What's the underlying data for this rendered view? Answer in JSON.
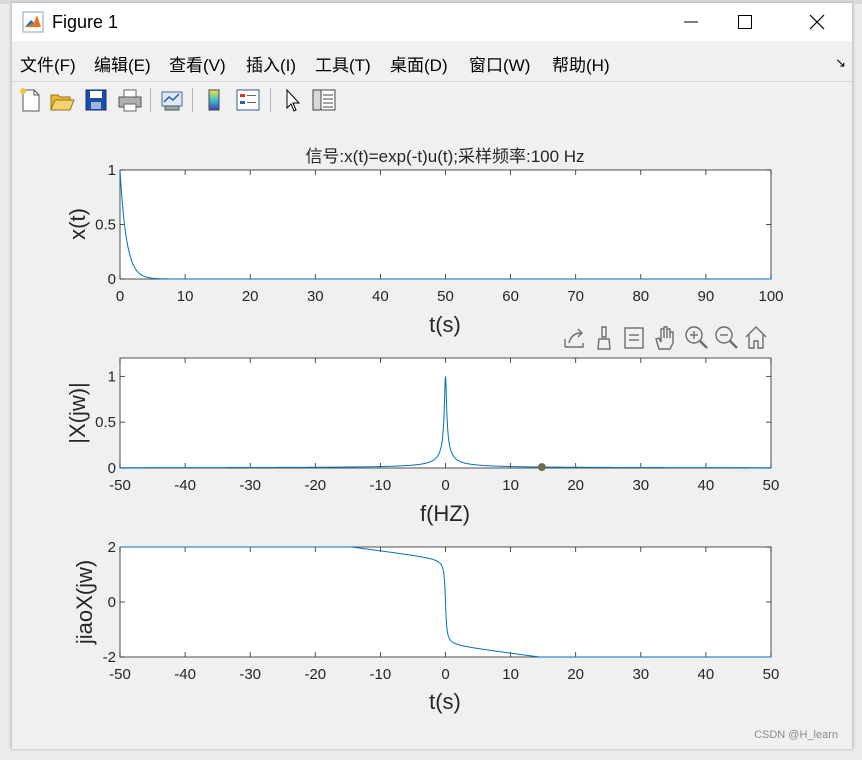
{
  "window": {
    "title": "Figure 1"
  },
  "menu": {
    "items": [
      {
        "label": "文件(F)"
      },
      {
        "label": "编辑(E)"
      },
      {
        "label": "查看(V)"
      },
      {
        "label": "插入(I)"
      },
      {
        "label": "工具(T)"
      },
      {
        "label": "桌面(D)"
      },
      {
        "label": "窗口(W)"
      },
      {
        "label": "帮助(H)"
      }
    ]
  },
  "toolbar": {
    "icons": [
      "new-figure-icon",
      "open-file-icon",
      "save-icon",
      "print-icon",
      "link-plot-icon",
      "colorbar-icon",
      "legend-icon",
      "pointer-icon",
      "property-inspector-icon"
    ]
  },
  "axes_toolbar": {
    "icons": [
      "export-icon",
      "brush-icon",
      "data-tips-icon",
      "pan-icon",
      "zoom-in-icon",
      "zoom-out-icon",
      "home-icon"
    ]
  },
  "watermark": "CSDN @H_learn",
  "chart_data": [
    {
      "type": "line",
      "title": "信号:x(t)=exp(-t)u(t);采样频率:100 Hz",
      "xlabel": "t(s)",
      "ylabel": "x(t)",
      "xlim": [
        0,
        100
      ],
      "ylim": [
        0,
        1
      ],
      "xticks": [
        "0",
        "10",
        "20",
        "30",
        "40",
        "50",
        "60",
        "70",
        "80",
        "90",
        "100"
      ],
      "yticks": [
        "0",
        "0.5",
        "1"
      ],
      "series": [
        {
          "function": "exp(-t)",
          "x_range": [
            0,
            100
          ],
          "color": "#0072bd"
        }
      ]
    },
    {
      "type": "line",
      "title": "",
      "xlabel": "f(HZ)",
      "ylabel": "|X(jw)|",
      "xlim": [
        -50,
        50
      ],
      "ylim": [
        0,
        1.2
      ],
      "xticks": [
        "-50",
        "-40",
        "-30",
        "-20",
        "-10",
        "0",
        "10",
        "20",
        "30",
        "40",
        "50"
      ],
      "yticks": [
        "0",
        "0.5",
        "1"
      ],
      "series": [
        {
          "function": "1/sqrt(1+(2*pi*f)^2)",
          "x_range": [
            -50,
            50
          ],
          "color": "#0072bd"
        }
      ],
      "marker": {
        "x": 14.8,
        "y": 0.01,
        "color": "#6b6b55"
      }
    },
    {
      "type": "line",
      "title": "",
      "xlabel": "t(s)",
      "ylabel": "jiaoX(jw)",
      "xlim": [
        -50,
        50
      ],
      "ylim": [
        -2,
        2
      ],
      "xticks": [
        "-50",
        "-40",
        "-30",
        "-20",
        "-10",
        "0",
        "10",
        "20",
        "30",
        "40",
        "50"
      ],
      "yticks": [
        "-2",
        "0",
        "2"
      ],
      "series": [
        {
          "function": "-atan(2*pi*f) with linear phase ramp",
          "x_range": [
            -50,
            50
          ],
          "color": "#0072bd"
        }
      ]
    }
  ]
}
